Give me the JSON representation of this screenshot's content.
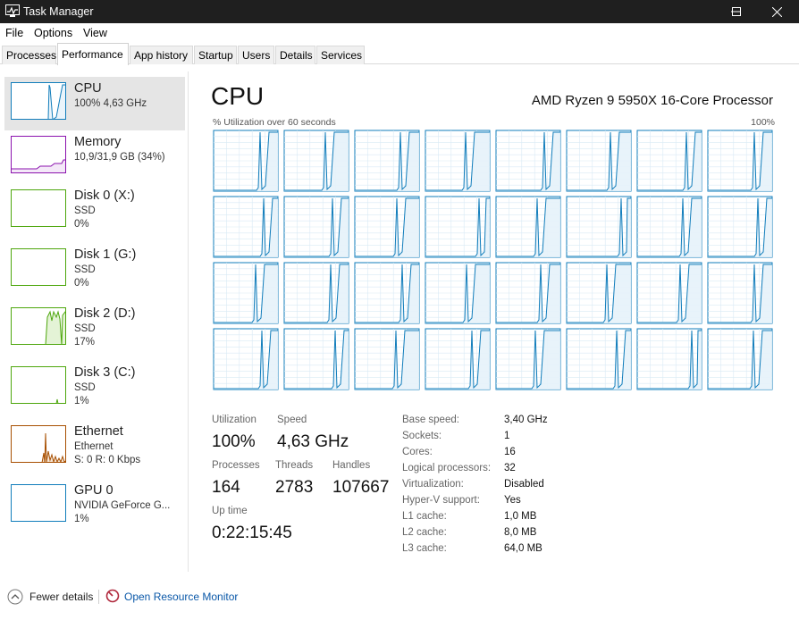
{
  "window": {
    "title": "Task Manager",
    "colors": {
      "titlebar": "#1f1f1f",
      "cpu": "#117dbb",
      "memory": "#8b12ae",
      "disk": "#4da60c",
      "ethernet": "#a74f01",
      "gpu": "#117dbb"
    }
  },
  "menu": {
    "file": "File",
    "options": "Options",
    "view": "View"
  },
  "tabs": {
    "processes": "Processes",
    "performance": "Performance",
    "app_history": "App history",
    "startup": "Startup",
    "users": "Users",
    "details": "Details",
    "services": "Services"
  },
  "sidebar": {
    "cpu": {
      "name": "CPU",
      "sub1": "100% 4,63 GHz"
    },
    "memory": {
      "name": "Memory",
      "sub1": "10,9/31,9 GB (34%)"
    },
    "disk0": {
      "name": "Disk 0 (X:)",
      "sub1": "SSD",
      "sub2": "0%"
    },
    "disk1": {
      "name": "Disk 1 (G:)",
      "sub1": "SSD",
      "sub2": "0%"
    },
    "disk2": {
      "name": "Disk 2 (D:)",
      "sub1": "SSD",
      "sub2": "17%"
    },
    "disk3": {
      "name": "Disk 3 (C:)",
      "sub1": "SSD",
      "sub2": "1%"
    },
    "ethernet": {
      "name": "Ethernet",
      "sub1": "Ethernet",
      "sub2": "S: 0 R: 0 Kbps"
    },
    "gpu": {
      "name": "GPU 0",
      "sub1": "NVIDIA GeForce G...",
      "sub2": "1%"
    }
  },
  "main": {
    "title": "CPU",
    "model": "AMD Ryzen 9 5950X 16-Core Processor",
    "graph_label": "% Utilization over 60 seconds",
    "graph_max": "100%",
    "logical_processor_graphs": 32
  },
  "stats": {
    "utilization": {
      "label": "Utilization",
      "value": "100%"
    },
    "speed": {
      "label": "Speed",
      "value": "4,63 GHz"
    },
    "processes": {
      "label": "Processes",
      "value": "164"
    },
    "threads": {
      "label": "Threads",
      "value": "2783"
    },
    "handles": {
      "label": "Handles",
      "value": "107667"
    },
    "uptime": {
      "label": "Up time",
      "value": "0:22:15:45"
    }
  },
  "specs": {
    "base_speed": {
      "label": "Base speed:",
      "value": "3,40 GHz"
    },
    "sockets": {
      "label": "Sockets:",
      "value": "1"
    },
    "cores": {
      "label": "Cores:",
      "value": "16"
    },
    "logical_processors": {
      "label": "Logical processors:",
      "value": "32"
    },
    "virtualization": {
      "label": "Virtualization:",
      "value": "Disabled"
    },
    "hyperv": {
      "label": "Hyper-V support:",
      "value": "Yes"
    },
    "l1": {
      "label": "L1 cache:",
      "value": "1,0 MB"
    },
    "l2": {
      "label": "L2 cache:",
      "value": "8,0 MB"
    },
    "l3": {
      "label": "L3 cache:",
      "value": "64,0 MB"
    }
  },
  "footer": {
    "fewer_details": "Fewer details",
    "resource_monitor": "Open Resource Monitor"
  }
}
